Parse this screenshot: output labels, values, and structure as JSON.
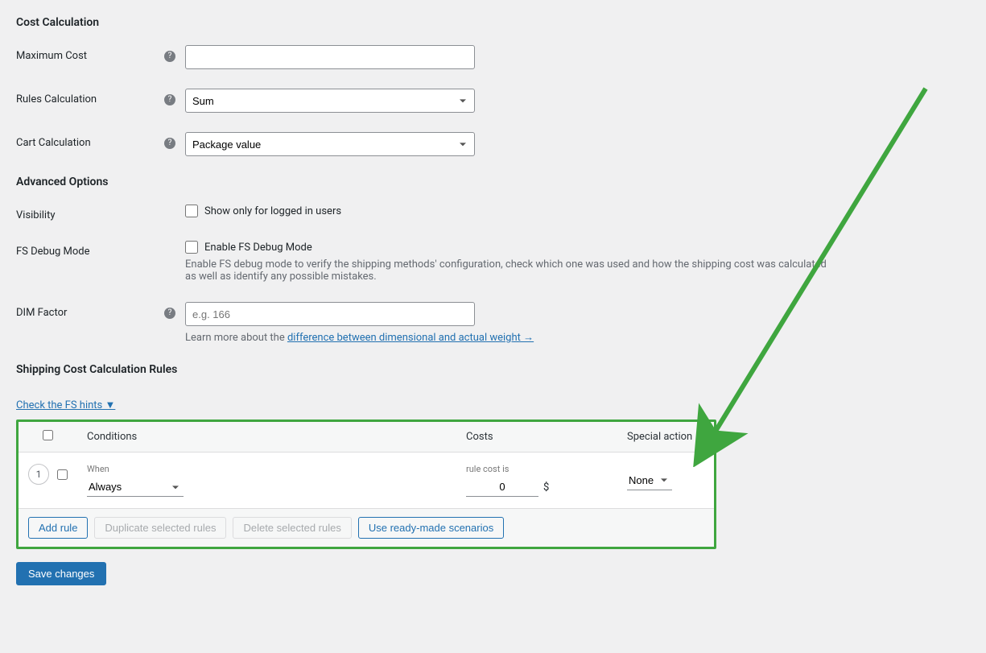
{
  "sections": {
    "cost_calc": "Cost Calculation",
    "advanced": "Advanced Options",
    "rules": "Shipping Cost Calculation Rules"
  },
  "labels": {
    "max_cost": "Maximum Cost",
    "rules_calc": "Rules Calculation",
    "cart_calc": "Cart Calculation",
    "visibility": "Visibility",
    "fs_debug": "FS Debug Mode",
    "dim": "DIM Factor"
  },
  "values": {
    "rules_calc": "Sum",
    "cart_calc": "Package value",
    "visibility_cb": "Show only for logged in users",
    "debug_cb": "Enable FS Debug Mode",
    "dim_placeholder": "e.g. 166"
  },
  "desc": {
    "debug": "Enable FS debug mode to verify the shipping methods' configuration, check which one was used and how the shipping cost was calculated as well as identify any possible mistakes.",
    "dim_prefix": "Learn more about the ",
    "dim_link": "difference between dimensional and actual weight →"
  },
  "hints_link": "Check the FS hints ▼",
  "table": {
    "headers": {
      "conditions": "Conditions",
      "costs": "Costs",
      "special": "Special action"
    },
    "row": {
      "num": "1",
      "when_label": "When",
      "when_value": "Always",
      "cost_label": "rule cost is",
      "cost_value": "0",
      "currency": "$",
      "special_value": "None"
    }
  },
  "buttons": {
    "add": "Add rule",
    "dup": "Duplicate selected rules",
    "del": "Delete selected rules",
    "ready": "Use ready-made scenarios",
    "save": "Save changes"
  }
}
